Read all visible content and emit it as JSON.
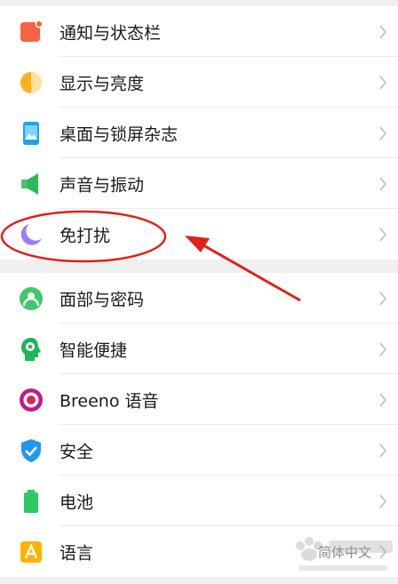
{
  "settings": {
    "items": [
      {
        "label": "通知与状态栏",
        "icon": "notification-icon"
      },
      {
        "label": "显示与亮度",
        "icon": "display-brightness-icon"
      },
      {
        "label": "桌面与锁屏杂志",
        "icon": "wallpaper-icon"
      },
      {
        "label": "声音与振动",
        "icon": "speaker-icon"
      },
      {
        "label": "免打扰",
        "icon": "moon-icon"
      },
      {
        "label": "面部与密码",
        "icon": "face-password-icon"
      },
      {
        "label": "智能便捷",
        "icon": "smart-assist-icon"
      },
      {
        "label": "Breeno 语音",
        "icon": "breeno-icon"
      },
      {
        "label": "安全",
        "icon": "shield-icon"
      },
      {
        "label": "电池",
        "icon": "battery-icon"
      },
      {
        "label": "语言",
        "icon": "language-icon",
        "value": "简体中文"
      }
    ]
  },
  "colors": {
    "annotation": "#e0201b",
    "chevron": "#c8c8c8",
    "section_gap": "#f0f0f0"
  }
}
